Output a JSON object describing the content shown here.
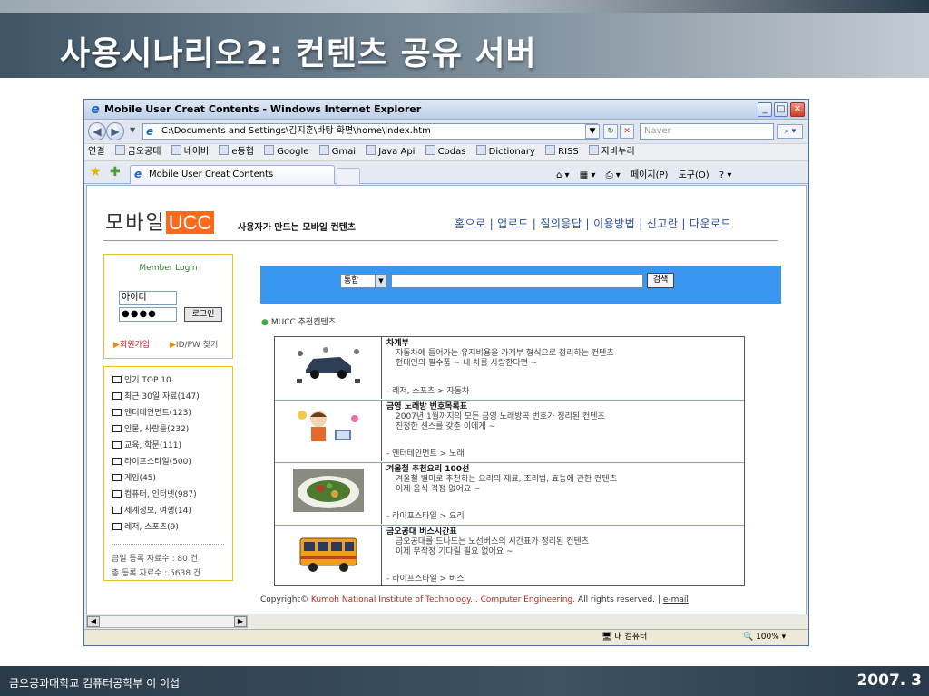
{
  "slide": {
    "title": "사용시나리오2: 컨텐츠 공유 서버",
    "footer_left": "금오공과대학교 컴퓨터공학부 이 이섭",
    "footer_right": "2007. 3"
  },
  "browser": {
    "window_title": "Mobile User Creat Contents - Windows Internet Explorer",
    "address": "C:\\Documents and Settings\\김지훈\\바탕 화면\\home\\index.htm",
    "search_placeholder": "Naver",
    "links_label": "연결",
    "links": [
      "금오공대",
      "네이버",
      "e동협",
      "Google",
      "Gmai",
      "Java Api",
      "Codas",
      "Dictionary",
      "RISS",
      "자바누리"
    ],
    "tab_title": "Mobile User Creat Contents",
    "tools": [
      "페이지(P)",
      "도구(O)"
    ],
    "status_zone": "내 컴퓨터",
    "zoom": "100%"
  },
  "site": {
    "logo_text": "모바일",
    "logo_highlight": "UCC",
    "tagline": "사용자가 만드는 모바일 컨텐츠",
    "nav": [
      "홈으로",
      "업로드",
      "질의응답",
      "이용방법",
      "신고란",
      "다운로드"
    ],
    "login": {
      "title": "Member Login",
      "id_value": "아이디",
      "pw_value": "●●●●",
      "button": "로그인",
      "join": "회원가입",
      "find": "ID/PW 찾기"
    },
    "categories": [
      "인기 TOP 10",
      "최근 30일 자료(147)",
      "엔터테인먼트(123)",
      "인물, 사람들(232)",
      "교육, 학문(111)",
      "라이프스타일(500)",
      "게임(45)",
      "컴퓨터, 인터넷(987)",
      "세계정보, 여행(14)",
      "레저, 스포츠(9)"
    ],
    "stats": [
      "금일 등록 자료수 : 80 건",
      "총 등록 자료수 : 5638 건"
    ],
    "search": {
      "select": "통합",
      "button": "검색"
    },
    "rec_heading": "MUCC 추천컨텐츠",
    "contents": [
      {
        "title": "차계부",
        "desc1": "자동차에 들어가는 유지비용을 가계부 형식으로 정리하는 컨텐츠",
        "desc2": "현대인의 필수품 ~ 내 차를 사랑한다면 ~",
        "category": "- 레저, 스포츠 > 자동차",
        "icon": "car-parts-icon"
      },
      {
        "title": "금영 노래방 번호목록표",
        "desc1": "2007년 1월까지의 모든 금영 노래방곡 번호가 정리된 컨텐츠",
        "desc2": "진정한 센스를 갖춘 이에게 ~",
        "category": "- 엔터테인먼트 > 노래",
        "icon": "karaoke-icon"
      },
      {
        "title": "겨울철 추천요리 100선",
        "desc1": "겨울철 별미로 추천하는 요리의 재료, 조리법, 효능에 관한 컨텐츠",
        "desc2": "이제 음식 걱정 없어요 ~",
        "category": "- 라이프스타일 > 요리",
        "icon": "salad-icon"
      },
      {
        "title": "금오공대 버스시간표",
        "desc1": "금오공대를 드나드는 노선버스의 시간표가 정리된 컨텐츠",
        "desc2": "이제 무작정 기다릴 필요 없어요 ~",
        "category": "- 라이프스타일 > 버스",
        "icon": "bus-icon"
      }
    ],
    "copyright_prefix": "Copyright©",
    "copyright_inst": "Kumoh National Institute of Technology... Computer Engineering.",
    "copyright_rights": "All rights reserved.",
    "copyright_sep": "|",
    "copyright_mail": "e-mail"
  }
}
